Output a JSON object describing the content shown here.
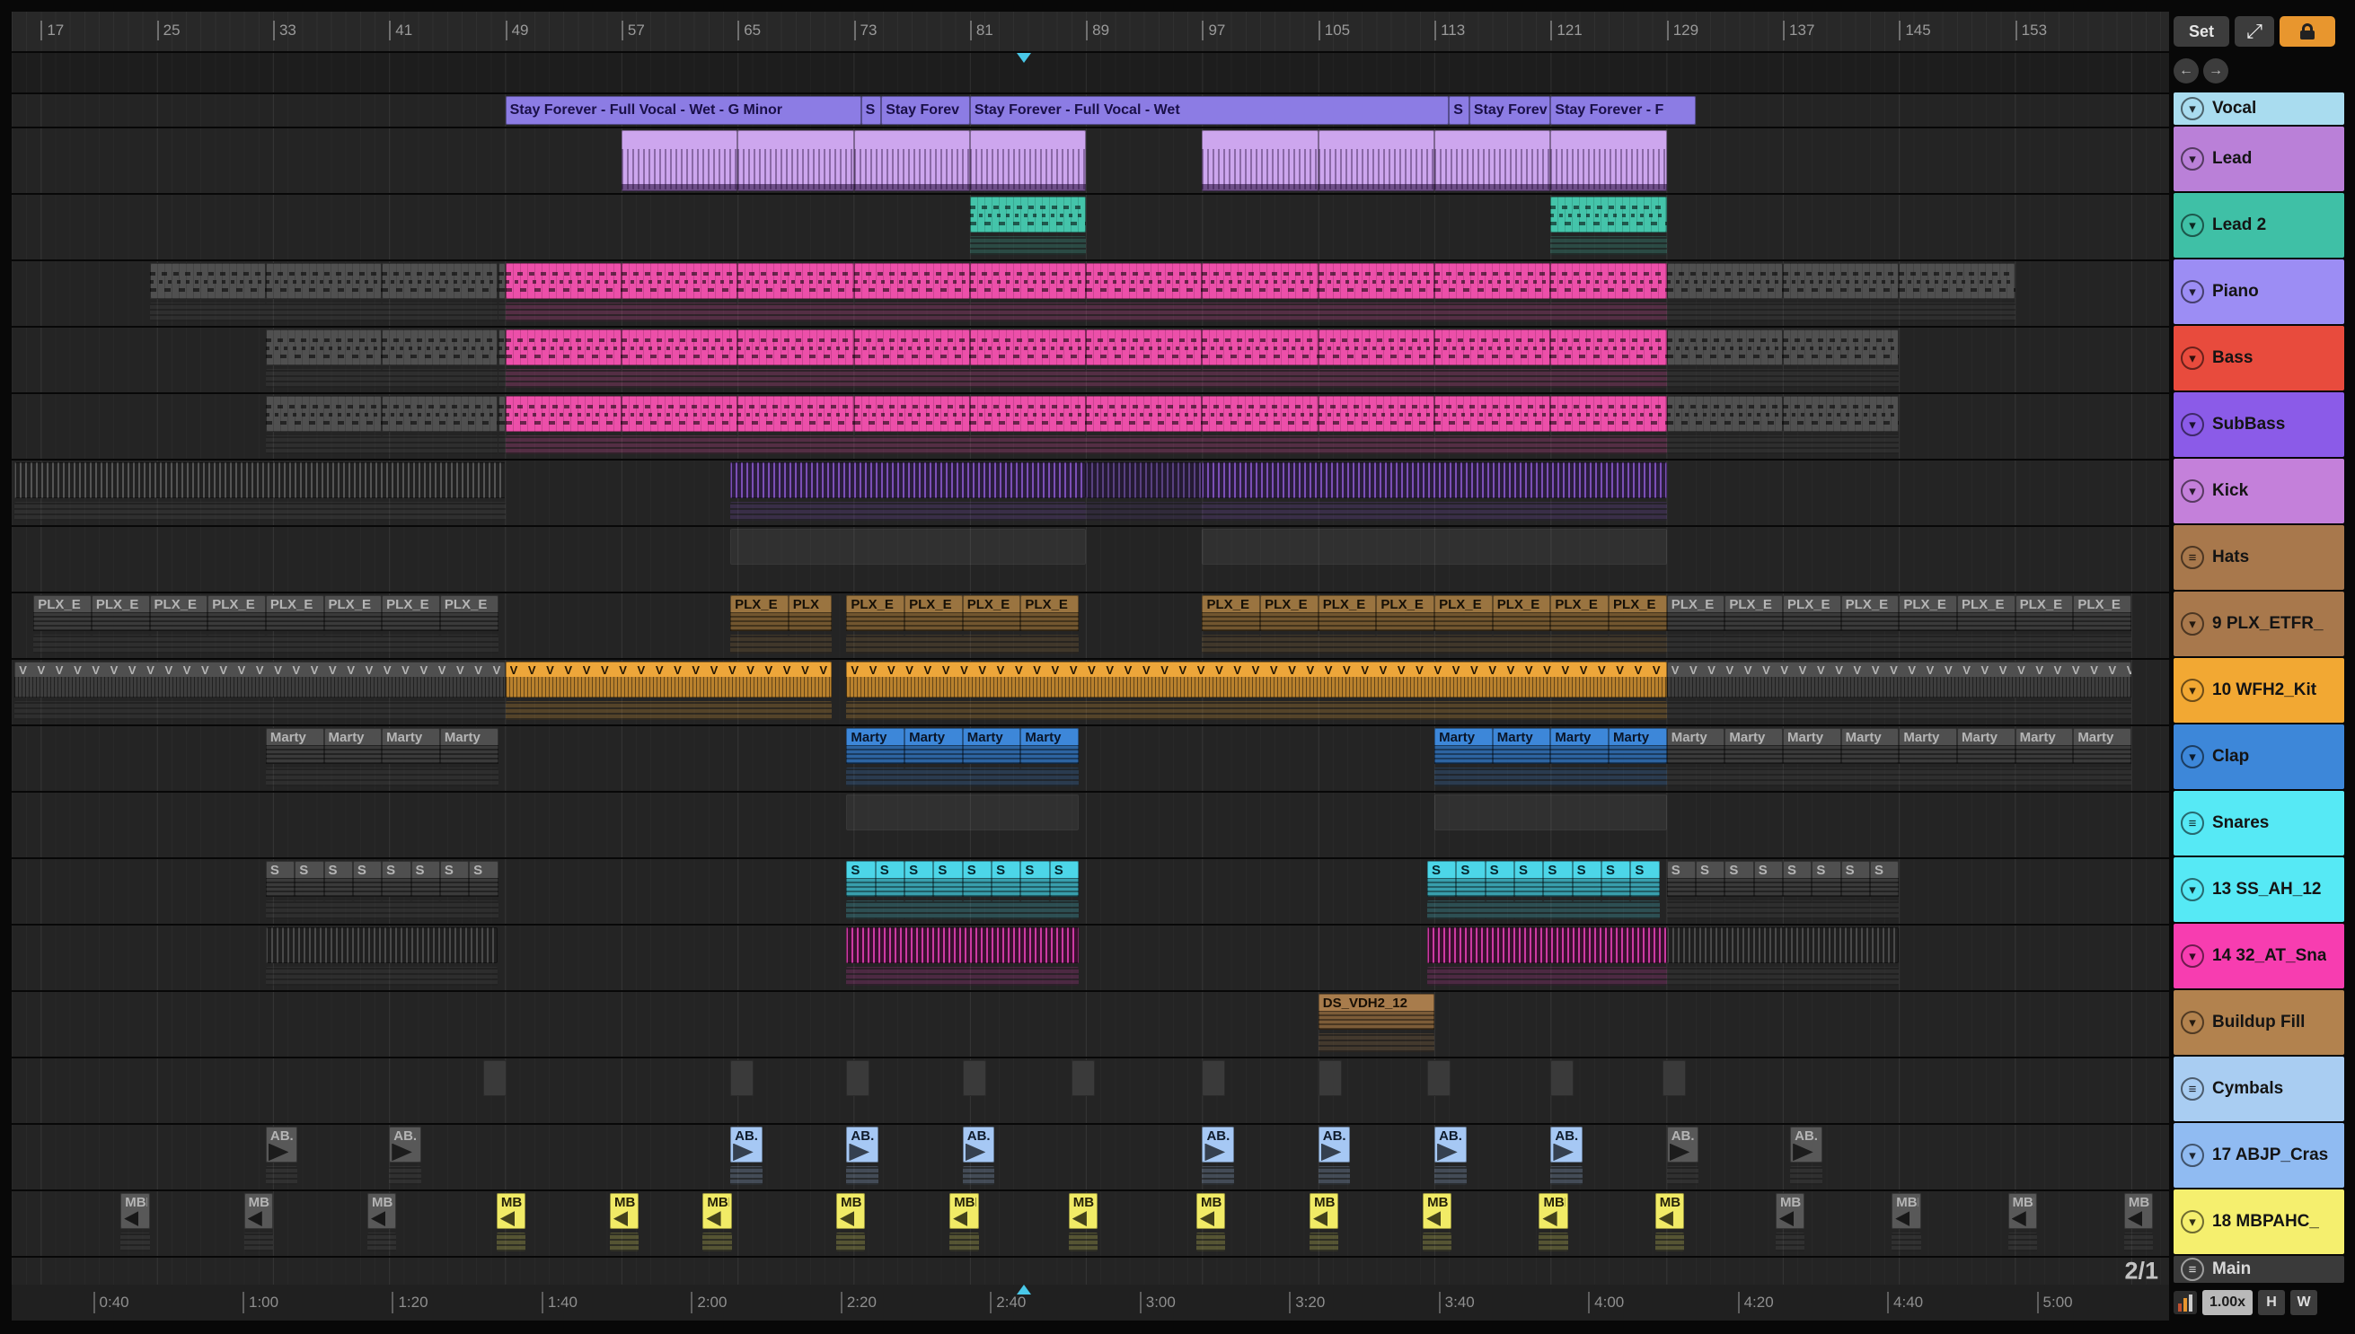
{
  "controls": {
    "set_label": "Set",
    "zoom": "1.00x",
    "h_label": "H",
    "w_label": "W"
  },
  "icons": {
    "resize": "⤢",
    "arrow_left": "←",
    "arrow_right": "→",
    "chevron": "▾",
    "lines": "≡"
  },
  "colors": {
    "accent_cyan": "#49c8e8",
    "lock_orange": "#e8962e",
    "pink": "#ec4fa9",
    "lead_violet": "#cda6ee",
    "orange": "#f2a833",
    "gray_clip": "#505050"
  },
  "ruler": {
    "bars": [
      17,
      25,
      33,
      41,
      49,
      57,
      65,
      73,
      81,
      89,
      97,
      105,
      113,
      121,
      129,
      137,
      145,
      153
    ]
  },
  "time_labels": [
    "0:40",
    "1:00",
    "1:20",
    "1:40",
    "2:00",
    "2:20",
    "2:40",
    "3:00",
    "3:20",
    "3:40",
    "4:00",
    "4:20",
    "4:40",
    "5:00"
  ],
  "playhead_bar": 84.7,
  "tracks": [
    {
      "name": "Vocal",
      "color": "#a9dcef",
      "icon": "chevron",
      "h": 36,
      "clips": [
        {
          "k": "name",
          "s": 49,
          "e": 73.5,
          "c": "#8c7ce4",
          "t": "#1a1048",
          "label": "Stay Forever - Full Vocal - Wet - G Minor"
        },
        {
          "k": "name",
          "s": 73.5,
          "e": 74.9,
          "c": "#8c7ce4",
          "t": "#1a1048",
          "label": "S"
        },
        {
          "k": "name",
          "s": 74.9,
          "e": 81,
          "c": "#8c7ce4",
          "t": "#1a1048",
          "label": "Stay Forev"
        },
        {
          "k": "name",
          "s": 81,
          "e": 114,
          "c": "#8c7ce4",
          "t": "#1a1048",
          "label": "Stay Forever - Full Vocal - Wet"
        },
        {
          "k": "name",
          "s": 114,
          "e": 115.4,
          "c": "#8c7ce4",
          "t": "#1a1048",
          "label": "S"
        },
        {
          "k": "name",
          "s": 115.4,
          "e": 121,
          "c": "#8c7ce4",
          "t": "#1a1048",
          "label": "Stay Forev"
        },
        {
          "k": "name",
          "s": 121,
          "e": 131,
          "c": "#8c7ce4",
          "t": "#1a1048",
          "label": "Stay Forever - F"
        }
      ]
    },
    {
      "name": "Lead",
      "color": "#ba80d8",
      "icon": "chevron",
      "h": 72,
      "clips": [
        {
          "k": "leadnotes",
          "s": 57,
          "e": 89,
          "seg": 8,
          "c": "#cda6ee"
        },
        {
          "k": "leadnotes",
          "s": 97,
          "e": 129,
          "seg": 8,
          "c": "#cda6ee"
        }
      ]
    },
    {
      "name": "Lead 2",
      "color": "#3fc0a6",
      "icon": "chevron",
      "h": 72,
      "clips": [
        {
          "k": "notes",
          "s": 81,
          "e": 89,
          "seg": 8,
          "c": "#44c4aa",
          "sub": true
        },
        {
          "k": "notes",
          "s": 121,
          "e": 129,
          "seg": 8,
          "c": "#44c4aa",
          "sub": true
        }
      ]
    },
    {
      "name": "Piano",
      "color": "#9c8df4",
      "icon": "chevron",
      "h": 72,
      "clips": [
        {
          "k": "notes",
          "s": 24.5,
          "e": 49,
          "seg": 8,
          "c": "#505050",
          "sub": true
        },
        {
          "k": "notes",
          "s": 49,
          "e": 129,
          "seg": 8,
          "c": "#ec4fa9",
          "sub": true
        },
        {
          "k": "notes",
          "s": 129,
          "e": 153,
          "seg": 8,
          "c": "#505050",
          "sub": true
        }
      ]
    },
    {
      "name": "Bass",
      "color": "#e84b3d",
      "icon": "chevron",
      "h": 72,
      "clips": [
        {
          "k": "notes",
          "s": 32.5,
          "e": 49,
          "seg": 8,
          "c": "#505050",
          "sub": true
        },
        {
          "k": "notes",
          "s": 49,
          "e": 129,
          "seg": 8,
          "c": "#ec4fa9",
          "sub": true
        },
        {
          "k": "notes",
          "s": 129,
          "e": 145,
          "seg": 8,
          "c": "#505050",
          "sub": true
        }
      ]
    },
    {
      "name": "SubBass",
      "color": "#8b5be8",
      "icon": "chevron",
      "h": 72,
      "clips": [
        {
          "k": "notes",
          "s": 32.5,
          "e": 49,
          "seg": 8,
          "c": "#505050",
          "sub": true
        },
        {
          "k": "notes",
          "s": 49,
          "e": 129,
          "seg": 8,
          "c": "#ec4fa9",
          "sub": true
        },
        {
          "k": "notes",
          "s": 129,
          "e": 145,
          "seg": 8,
          "c": "#505050",
          "sub": true
        }
      ]
    },
    {
      "name": "Kick",
      "color": "#c480da",
      "icon": "chevron",
      "h": 72,
      "clips": [
        {
          "k": "stripes",
          "s": 15.2,
          "e": 49,
          "c": "#555555",
          "c2": "#212121",
          "sub": true
        },
        {
          "k": "stripes",
          "s": 64.5,
          "e": 89,
          "c": "#7b4fb5",
          "c2": "#2a1d3d",
          "sub": true
        },
        {
          "k": "stripes",
          "s": 89,
          "e": 97,
          "c": "#58407f",
          "c2": "#241a33",
          "sub": true
        },
        {
          "k": "stripes",
          "s": 97,
          "e": 129,
          "c": "#7b4fb5",
          "c2": "#2a1d3d",
          "sub": true
        }
      ]
    },
    {
      "name": "Hats",
      "color": "#a8784c",
      "icon": "lines",
      "h": 72,
      "clips": [
        {
          "k": "dim",
          "s": 64.5,
          "e": 89
        },
        {
          "k": "dim",
          "s": 97,
          "e": 129
        }
      ]
    },
    {
      "name": "9 PLX_ETFR_",
      "color": "#a8784c",
      "icon": "chevron",
      "h": 72,
      "clips": [
        {
          "k": "sample",
          "w": 4,
          "starts": [
            16.5,
            20.5,
            24.5,
            28.5,
            32.5,
            36.5,
            40.5,
            44.5
          ],
          "c": "#4f4f4f",
          "t": "#b5b5b5",
          "label": "PLX_E",
          "sub": true
        },
        {
          "k": "sample",
          "w": 4,
          "starts": [
            64.5
          ],
          "c": "#9a7440",
          "t": "#161007",
          "label": "PLX_E",
          "sub": true
        },
        {
          "k": "sample",
          "w": 3,
          "starts": [
            68.5
          ],
          "c": "#9a7440",
          "t": "#161007",
          "label": "PLX",
          "sub": true
        },
        {
          "k": "sample",
          "w": 4,
          "starts": [
            72.5,
            76.5,
            80.5,
            84.5
          ],
          "c": "#9a7440",
          "t": "#161007",
          "label": "PLX_E",
          "sub": true
        },
        {
          "k": "sample",
          "w": 4,
          "starts": [
            97,
            101,
            105,
            109
          ],
          "c": "#9a7440",
          "t": "#161007",
          "label": "PLX_E",
          "sub": true
        },
        {
          "k": "sample",
          "w": 4,
          "starts": [
            113,
            117,
            121,
            125
          ],
          "c": "#9a7440",
          "t": "#161007",
          "label": "PLX_E",
          "sub": true
        },
        {
          "k": "sample",
          "w": 4,
          "starts": [
            129,
            133,
            137,
            141,
            145,
            149,
            153,
            157
          ],
          "c": "#4f4f4f",
          "t": "#b5b5b5",
          "label": "PLX_E",
          "sub": true
        }
      ]
    },
    {
      "name": "10 WFH2_Kit",
      "color": "#f2a833",
      "icon": "chevron",
      "h": 72,
      "clips": [
        {
          "k": "vclip",
          "s": 15.2,
          "e": 49,
          "c": "#4f4f4f",
          "t": "#b5b5b5",
          "label": "V",
          "rep": true,
          "sub": true
        },
        {
          "k": "vclip",
          "s": 49,
          "e": 71.5,
          "c": "#eda63a",
          "t": "#201505",
          "label": "V",
          "rep": true,
          "sub": true
        },
        {
          "k": "vclip",
          "s": 72.5,
          "e": 129,
          "c": "#eda63a",
          "t": "#201505",
          "label": "V",
          "rep": true,
          "sub": true
        },
        {
          "k": "vclip",
          "s": 129,
          "e": 161,
          "c": "#4f4f4f",
          "t": "#b5b5b5",
          "label": "V",
          "rep": true,
          "sub": true
        }
      ]
    },
    {
      "name": "Clap",
      "color": "#3d87d9",
      "icon": "chevron",
      "h": 72,
      "clips": [
        {
          "k": "sample",
          "w": 4,
          "starts": [
            32.5,
            36.5,
            40.5,
            44.5
          ],
          "c": "#4f4f4f",
          "t": "#b5b5b5",
          "label": "Marty",
          "sub": true
        },
        {
          "k": "sample",
          "w": 4,
          "starts": [
            72.5,
            76.5,
            80.5,
            84.5
          ],
          "c": "#3d87d9",
          "t": "#0a1528",
          "label": "Marty",
          "sub": true
        },
        {
          "k": "sample",
          "w": 4,
          "starts": [
            113,
            117,
            121,
            125
          ],
          "c": "#3d87d9",
          "t": "#0a1528",
          "label": "Marty",
          "sub": true
        },
        {
          "k": "sample",
          "w": 4,
          "starts": [
            129,
            133,
            137,
            141,
            145,
            149,
            153,
            157
          ],
          "c": "#4f4f4f",
          "t": "#b5b5b5",
          "label": "Marty",
          "sub": true
        }
      ]
    },
    {
      "name": "Snares",
      "color": "#56e9f5",
      "icon": "lines",
      "h": 72,
      "clips": [
        {
          "k": "dim",
          "s": 72.5,
          "e": 88.5
        },
        {
          "k": "dim",
          "s": 113,
          "e": 129
        }
      ]
    },
    {
      "name": "13 SS_AH_12",
      "color": "#56e9f5",
      "icon": "chevron",
      "h": 72,
      "clips": [
        {
          "k": "sample",
          "w": 2,
          "starts": [
            32.5,
            34.5,
            36.5,
            38.5,
            40.5,
            42.5,
            44.5,
            46.5
          ],
          "c": "#4f4f4f",
          "t": "#b5b5b5",
          "label": "S",
          "sub": true
        },
        {
          "k": "sample",
          "w": 2,
          "starts": [
            72.5,
            74.5,
            76.5,
            78.5,
            80.5,
            82.5,
            84.5,
            86.5
          ],
          "c": "#4cd6e8",
          "t": "#06252c",
          "label": "S",
          "sub": true
        },
        {
          "k": "sample",
          "w": 2,
          "starts": [
            112.5,
            114.5,
            116.5,
            118.5,
            120.5,
            122.5,
            124.5,
            126.5
          ],
          "c": "#4cd6e8",
          "t": "#06252c",
          "label": "S",
          "sub": true
        },
        {
          "k": "sample",
          "w": 2,
          "starts": [
            129,
            131,
            133,
            135,
            137,
            139,
            141,
            143
          ],
          "c": "#4f4f4f",
          "t": "#b5b5b5",
          "label": "S",
          "sub": true
        }
      ]
    },
    {
      "name": "14 32_AT_Sna",
      "color": "#f73db0",
      "icon": "chevron",
      "h": 72,
      "clips": [
        {
          "k": "stripes",
          "s": 32.5,
          "e": 48.5,
          "c": "#4a4a4a",
          "c2": "#1f1f1f",
          "sub": true
        },
        {
          "k": "stripes",
          "s": 72.5,
          "e": 88.5,
          "c": "#cc3aa2",
          "c2": "#39102e",
          "sub": true
        },
        {
          "k": "stripes",
          "s": 112.5,
          "e": 129,
          "c": "#cc3aa2",
          "c2": "#39102e",
          "sub": true
        },
        {
          "k": "stripes",
          "s": 129,
          "e": 145,
          "c": "#4a4a4a",
          "c2": "#1f1f1f",
          "sub": true
        }
      ]
    },
    {
      "name": "Buildup Fill",
      "color": "#b2824e",
      "icon": "chevron",
      "h": 72,
      "clips": [
        {
          "k": "sample",
          "s": 105,
          "e": 113,
          "c": "#a87c4c",
          "t": "#180f05",
          "label": "DS_VDH2_12",
          "sub": true
        }
      ]
    },
    {
      "name": "Cymbals",
      "color": "#a9cdf2",
      "icon": "lines",
      "h": 72,
      "clips": [
        {
          "k": "dim2",
          "w": 1.6,
          "starts": [
            47.5,
            64.5,
            72.5,
            80.5,
            88,
            97,
            105,
            112.5,
            121,
            128.7
          ]
        }
      ]
    },
    {
      "name": "17 ABJP_Cras",
      "color": "#90bbf2",
      "icon": "chevron",
      "h": 72,
      "clips": [
        {
          "k": "abclip",
          "w": 2.2,
          "starts": [
            32.5,
            41
          ],
          "c": "#585858",
          "t": "#b5b5b5",
          "label": "AB.",
          "sub": true
        },
        {
          "k": "abclip",
          "w": 2.2,
          "starts": [
            64.5,
            72.5,
            80.5,
            97,
            105,
            113,
            121
          ],
          "c": "#a6c8f4",
          "t": "#0f1b2b",
          "label": "AB.",
          "sub": true
        },
        {
          "k": "abclip",
          "w": 2.2,
          "starts": [
            129,
            137.5
          ],
          "c": "#585858",
          "t": "#b5b5b5",
          "label": "AB.",
          "sub": true
        }
      ]
    },
    {
      "name": "18 MBPAHC_",
      "color": "#f5ef6e",
      "icon": "chevron",
      "h": 72,
      "clips": [
        {
          "k": "mbpclip",
          "w": 2,
          "starts": [
            22.5,
            31,
            39.5
          ],
          "c": "#585858",
          "t": "#b5b5b5",
          "label": "MBP",
          "sub": true
        },
        {
          "k": "mbpclip",
          "w": 2,
          "starts": [
            48.4,
            56.2,
            62.6,
            71.8,
            79.6,
            87.8,
            96.6,
            104.4,
            112.2,
            120.2,
            128.2
          ],
          "c": "#f1eb66",
          "t": "#26220a",
          "labels": [
            "MB",
            "MBP",
            "MBP",
            "MBP",
            "MBP",
            "MBP",
            "MBP",
            "MBP",
            "MBP",
            "MBP",
            "MBP"
          ],
          "sub": true
        },
        {
          "k": "mbpclip",
          "w": 2,
          "starts": [
            136.5,
            144.5,
            152.5,
            160.5
          ],
          "c": "#585858",
          "t": "#b5b5b5",
          "label": "MBP",
          "sub": true
        }
      ]
    },
    {
      "name": "Main",
      "color": "#3a3a3a",
      "icon": "lines",
      "h": 30,
      "dark": true,
      "tag": "2/1",
      "clips": []
    }
  ]
}
